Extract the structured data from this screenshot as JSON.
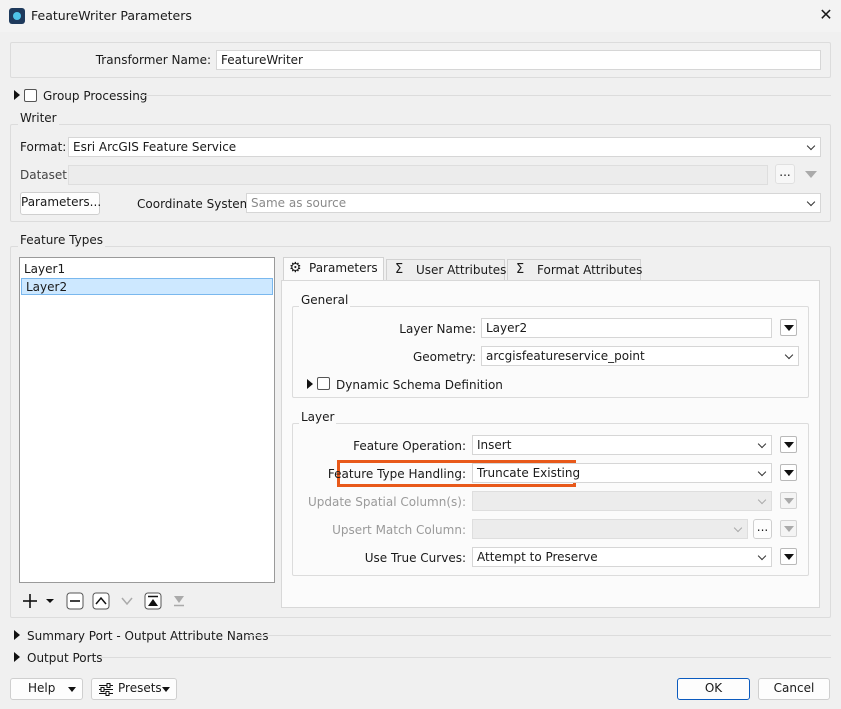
{
  "window": {
    "title": "FeatureWriter Parameters"
  },
  "transformer": {
    "label": "Transformer Name:",
    "value": "FeatureWriter"
  },
  "group_processing": {
    "label": "Group Processing"
  },
  "writer": {
    "group_label": "Writer",
    "format_label": "Format:",
    "format_value": "Esri ArcGIS Feature Service",
    "dataset_label": "Dataset:",
    "dataset_value": "",
    "browse_label": "...",
    "parameters_button": "Parameters...",
    "coord_label": "Coordinate System:",
    "coord_placeholder": "Same as source"
  },
  "feature_types": {
    "group_label": "Feature Types",
    "items": [
      "Layer1",
      "Layer2"
    ],
    "selected": "Layer2"
  },
  "tabs": [
    {
      "label": "Parameters",
      "icon": "gear-icon"
    },
    {
      "label": "User Attributes",
      "icon": "sigma-icon"
    },
    {
      "label": "Format Attributes",
      "icon": "sigma-icon"
    }
  ],
  "general": {
    "group_label": "General",
    "layer_name_label": "Layer Name:",
    "layer_name_value": "Layer2",
    "geometry_label": "Geometry:",
    "geometry_value": "arcgisfeatureservice_point",
    "dynamic_schema_label": "Dynamic Schema Definition"
  },
  "layer": {
    "group_label": "Layer",
    "feature_operation_label": "Feature Operation:",
    "feature_operation_value": "Insert",
    "feature_type_handling_label": "Feature Type Handling:",
    "feature_type_handling_value": "Truncate Existing",
    "update_spatial_label": "Update Spatial Column(s):",
    "upsert_match_label": "Upsert Match Column:",
    "true_curves_label": "Use True Curves:",
    "true_curves_value": "Attempt to Preserve",
    "browse_label": "..."
  },
  "sections": {
    "summary_port": "Summary Port - Output Attribute Names",
    "output_ports": "Output Ports"
  },
  "footer": {
    "help": "Help",
    "presets": "Presets",
    "ok": "OK",
    "cancel": "Cancel"
  },
  "colors": {
    "highlight": "#e8591a",
    "selection": "#cde8ff",
    "accent": "#0b5bbf"
  }
}
